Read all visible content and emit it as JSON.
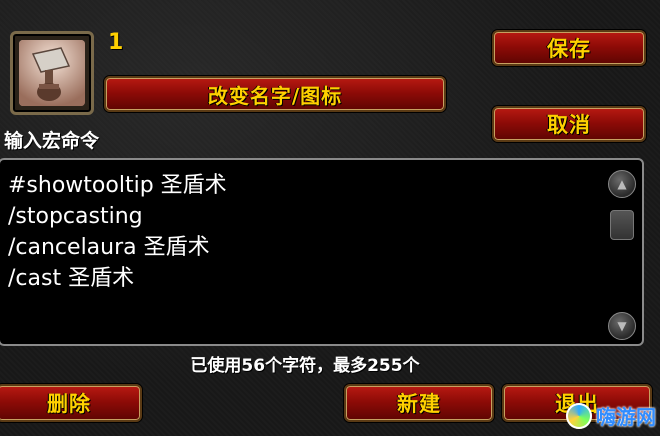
{
  "macro": {
    "icon": "hammer-fist-icon",
    "number": "1"
  },
  "buttons": {
    "change_name_icon": "改变名字/图标",
    "save": "保存",
    "cancel": "取消",
    "delete": "删除",
    "new": "新建",
    "exit": "退出"
  },
  "editor": {
    "prompt": "输入宏命令",
    "lines": [
      "#showtooltip 圣盾术",
      "/stopcasting",
      "/cancelaura 圣盾术",
      "/cast 圣盾术"
    ]
  },
  "status": {
    "char_count": "已使用56个字符，最多255个"
  },
  "watermark": {
    "text": "嗨游网"
  },
  "colors": {
    "label_gold": "#ffd100",
    "button_red": "#8e0b07",
    "editor_bg": "#000000"
  }
}
